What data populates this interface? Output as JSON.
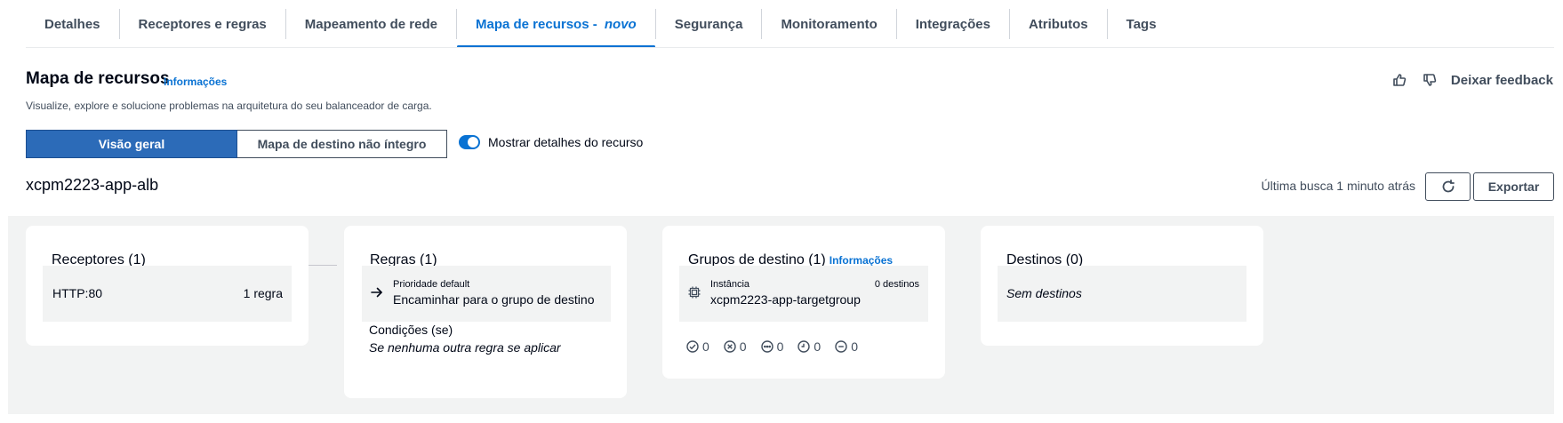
{
  "tabs": [
    {
      "label": "Detalhes",
      "active": false
    },
    {
      "label": "Receptores e regras",
      "active": false
    },
    {
      "label": "Mapeamento de rede",
      "active": false
    },
    {
      "label": "Mapa de recursos - ",
      "suffix": "novo",
      "active": true
    },
    {
      "label": "Segurança",
      "active": false
    },
    {
      "label": "Monitoramento",
      "active": false
    },
    {
      "label": "Integrações",
      "active": false
    },
    {
      "label": "Atributos",
      "active": false
    },
    {
      "label": "Tags",
      "active": false
    }
  ],
  "header": {
    "title": "Mapa de recursos",
    "info": "Informações",
    "description": "Visualize, explore e solucione problemas na arquitetura do seu balanceador de carga.",
    "feedback_label": "Deixar feedback",
    "thumbs_up_icon": "thumbs-up-icon",
    "thumbs_down_icon": "thumbs-down-icon"
  },
  "view_toggle": {
    "overview": "Visão geral",
    "unhealthy": "Mapa de destino não íntegro",
    "show_details_label": "Mostrar detalhes do recurso",
    "show_details_on": true
  },
  "resource": {
    "name": "xcpm2223-app-alb",
    "last_fetch": "Última busca 1 minuto atrás",
    "export_label": "Exportar"
  },
  "map": {
    "listeners": {
      "title": "Receptores (1)",
      "item": {
        "protocol": "HTTP:80",
        "rules": "1 regra"
      }
    },
    "rules": {
      "title": "Regras (1)",
      "item": {
        "priority": "Prioridade default",
        "action": "Encaminhar para o grupo de destino"
      },
      "conditions_label": "Condições (se)",
      "conditions_value": "Se nenhuma outra regra se aplicar"
    },
    "target_groups": {
      "title": "Grupos de destino (1)",
      "info": "Informações",
      "item": {
        "type": "Instância",
        "targets": "0 destinos",
        "name": "xcpm2223-app-targetgroup"
      },
      "statuses": [
        {
          "icon": "check-circle-icon",
          "count": "0"
        },
        {
          "icon": "x-circle-icon",
          "count": "0"
        },
        {
          "icon": "ellipsis-circle-icon",
          "count": "0"
        },
        {
          "icon": "clock-circle-icon",
          "count": "0"
        },
        {
          "icon": "minus-circle-icon",
          "count": "0"
        }
      ]
    },
    "targets": {
      "title": "Destinos (0)",
      "empty": "Sem destinos"
    }
  },
  "colors": {
    "accent": "#0972d3",
    "segment_active": "#2c6bb8",
    "canvas_bg": "#f2f3f3"
  }
}
